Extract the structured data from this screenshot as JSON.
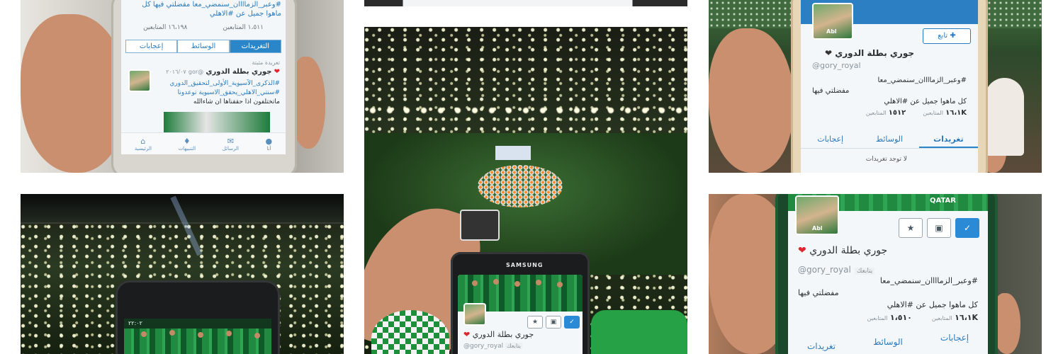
{
  "tiles": {
    "top_left": {
      "tweet_tag": "#وعبر_الزماااان_سنمضي_معا مفضلتي فيها كل ماهوا جميل عن #الاهلي",
      "stats": [
        "١٦،١٩٨ المتابعين",
        "١،٥١١ المتابعين"
      ],
      "tabs": [
        "إعجابات",
        "الوسائط",
        "التغريدات"
      ],
      "pinned_label": "تغريدة مثبتة",
      "tweet_name": "جوري بطلة الدوري",
      "tweet_handle": "@gor",
      "tweet_date": "٢٠١٦/٠٧",
      "tweet_line1": "#الذكرى_الآسيوية_الأولى_لتحقيق_الدوري",
      "tweet_line2": "#سنتي_الاهلي_يحقق_الاسيوية توعدونا",
      "tweet_line3": "ماتختلفون اذا حققناها ان شاءالله",
      "nav_labels": [
        "الرئيسية",
        "التنبيهات",
        "الرسائل",
        "أنا"
      ]
    },
    "top_right": {
      "follow_label": "تابع",
      "name": "جوري بطلة الدوري",
      "handle": "@gory_royal",
      "bio1": "#وعبر_الزماااان_سنمضي_معا",
      "bio2": "مفضلتي فيها",
      "bio3": "كل ماهوا جميل عن #الاهلي",
      "followers": "١٦،١K",
      "followers_label": "المتابعين",
      "following": "١٥١٢",
      "following_label": "المتابعين",
      "tabs": [
        "إعجابات",
        "الوسائط",
        "تغريدات"
      ],
      "empty": "لا توجد تغريدات",
      "avatar_caption": "Abl"
    },
    "center": {
      "phone_brand": "SAMSUNG",
      "name": "جوري بطلة الدوري",
      "handle": "@gory_royal",
      "follows_you": "يتابعك"
    },
    "bottom_left": {
      "status_time": "٢٢:٠٢"
    },
    "bottom_right": {
      "name": "جوري بطلة الدوري",
      "handle": "@gory_royal",
      "follows_you": "يتابعك",
      "bio1": "#وعبر_الزماااان_سنمضي_معا",
      "bio2": "مفضلتي فيها",
      "bio3": "كل ماهوا جميل عن #الاهلي",
      "followers": "١٦،١K",
      "followers_label": "المتابعين",
      "following": "١،٥١٠",
      "following_label": "المتابعين",
      "tabs": [
        "إعجابات",
        "الوسائط",
        "تغريدات"
      ],
      "avatar_caption": "Abl",
      "banner_text": "QATAR"
    }
  },
  "colors": {
    "twitter_blue": "#2a86c8",
    "heart_red": "#e0252f",
    "al_ahli_green": "#2fa553"
  }
}
